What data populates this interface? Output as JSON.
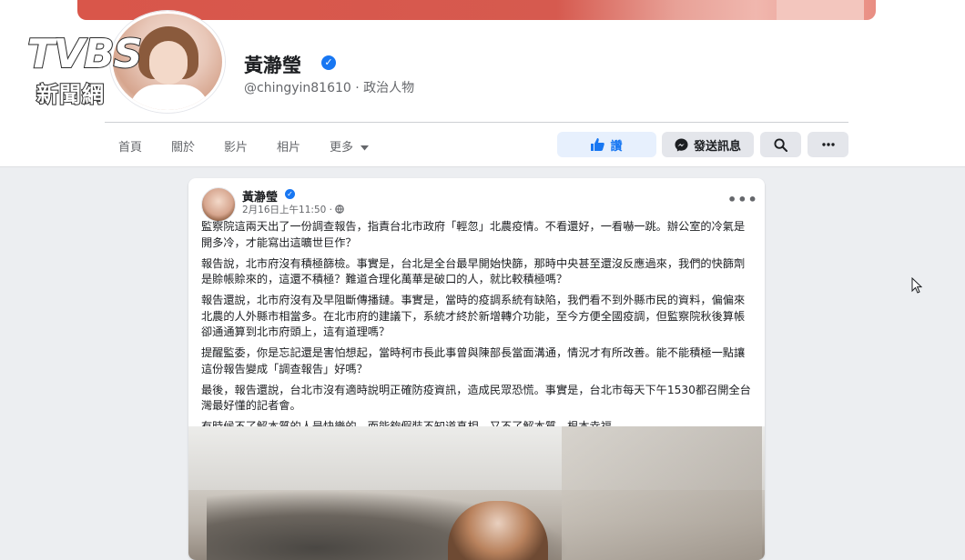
{
  "profile": {
    "name": "黃瀞瑩",
    "handle": "@chingyin81610 · 政治人物"
  },
  "watermark": {
    "brand": "TVBS",
    "sub": "新聞網"
  },
  "nav": {
    "items": [
      "首頁",
      "關於",
      "影片",
      "相片",
      "更多"
    ]
  },
  "actions": {
    "like": "讚",
    "message": "發送訊息"
  },
  "post": {
    "author": "黃瀞瑩",
    "time": "2月16日上午11:50 · ",
    "paragraphs": [
      "監察院這兩天出了一份調查報告，指責台北市政府「輕忽」北農疫情。不看還好，一看嚇一跳。辦公室的冷氣是開多冷，才能寫出這曠世巨作？",
      "報告說，北市府沒有積極篩檢。事實是，台北是全台最早開始快篩，那時中央甚至還沒反應過來，我們的快篩劑是賒帳賒來的，這還不積極？難道合理化萬華是破口的人，就比較積極嗎？",
      "報告還說，北市府沒有及早阻斷傳播鏈。事實是，當時的疫調系統有缺陷，我們看不到外縣市民的資料，偏偏來北農的人外縣市相當多。在北市府的建議下，系統才終於新增轉介功能，至今方便全國疫調，但監察院秋後算帳卻通通算到北市府頭上，這有道理嗎？",
      "提醒監委，你是忘記還是害怕想起，當時柯市長此事曾與陳部長當面溝通，情況才有所改善。能不能積極一點讓這份報告變成「調查報告」好嗎？",
      "最後，報告還說，台北市沒有適時說明正確防疫資訊，造成民眾恐慌。事實是，台北市每天下午1530都召開全台灣最好懂的記者會。",
      "有時候不了解本質的人是快樂的。而能夠假裝不知道真相、又不了解本質，根本幸福。"
    ]
  },
  "icons": {
    "verified": "verified-badge-icon",
    "like": "thumbs-up-icon",
    "messenger": "messenger-icon",
    "search": "search-icon",
    "more": "more-dots-icon",
    "globe": "globe-icon",
    "dropdown": "caret-down-icon",
    "cursor": "mouse-pointer-icon"
  },
  "colors": {
    "accent": "#1877f2",
    "cover": "#d9564a"
  }
}
